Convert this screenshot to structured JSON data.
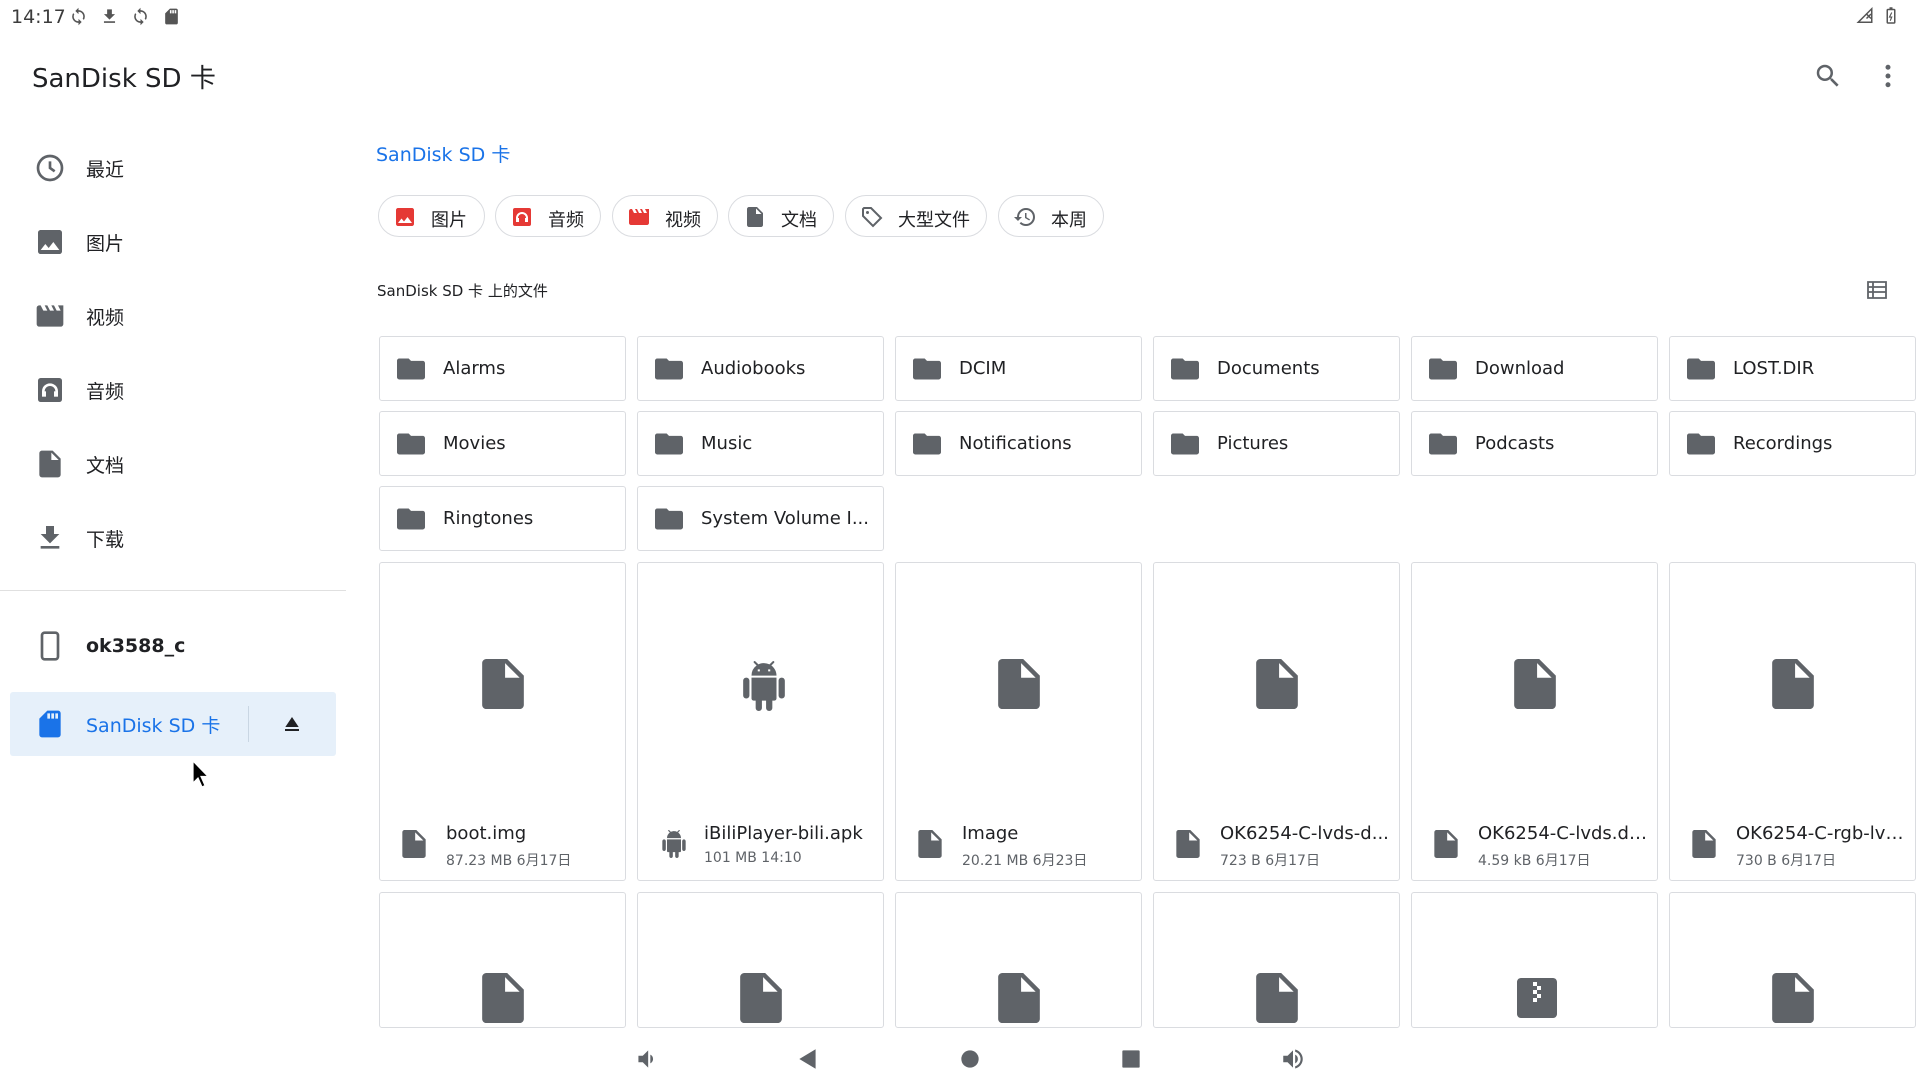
{
  "status_bar": {
    "time": "14:17",
    "left_icons": [
      "sync-icon",
      "download-icon",
      "sync-icon",
      "sd-card-icon"
    ],
    "right_icons": [
      "signal-icon",
      "battery-icon"
    ]
  },
  "app_bar": {
    "title": "SanDisk SD 卡",
    "actions": [
      "search-icon",
      "more-vert-icon"
    ]
  },
  "sidebar": {
    "items": [
      {
        "label": "最近",
        "icon": "clock-icon"
      },
      {
        "label": "图片",
        "icon": "image-icon"
      },
      {
        "label": "视频",
        "icon": "video-icon"
      },
      {
        "label": "音频",
        "icon": "headphones-icon"
      },
      {
        "label": "文档",
        "icon": "document-icon"
      },
      {
        "label": "下载",
        "icon": "download-icon"
      }
    ],
    "devices": [
      {
        "label": "ok3588_c",
        "icon": "phone-icon"
      },
      {
        "label": "SanDisk SD 卡",
        "icon": "sd-card-icon",
        "active": true,
        "action": "eject-icon"
      }
    ]
  },
  "main": {
    "breadcrumb": "SanDisk SD 卡",
    "chips": [
      {
        "label": "图片",
        "icon": "image-icon",
        "color": "#e53935"
      },
      {
        "label": "音频",
        "icon": "headphones-icon",
        "color": "#e53935"
      },
      {
        "label": "视频",
        "icon": "video-icon",
        "color": "#e53935"
      },
      {
        "label": "文档",
        "icon": "document-icon",
        "color": "#5f6368"
      },
      {
        "label": "大型文件",
        "icon": "tag-icon",
        "color": "#5f6368"
      },
      {
        "label": "本周",
        "icon": "history-icon",
        "color": "#5f6368"
      }
    ],
    "section_title": "SanDisk SD 卡 上的文件",
    "folders": [
      "Alarms",
      "Audiobooks",
      "DCIM",
      "Documents",
      "Download",
      "LOST.DIR",
      "Movies",
      "Music",
      "Notifications",
      "Pictures",
      "Podcasts",
      "Recordings",
      "Ringtones",
      "System Volume I..."
    ],
    "files": [
      {
        "name": "boot.img",
        "meta": "87.23 MB 6月17日",
        "icon": "file-icon"
      },
      {
        "name": "iBiliPlayer-bili.apk",
        "meta": "101 MB 14:10",
        "icon": "android-icon"
      },
      {
        "name": "Image",
        "meta": "20.21 MB 6月23日",
        "icon": "file-icon"
      },
      {
        "name": "OK6254-C-lvds-d...",
        "meta": "723 B 6月17日",
        "icon": "file-icon"
      },
      {
        "name": "OK6254-C-lvds.dt...",
        "meta": "4.59 kB 6月17日",
        "icon": "file-icon"
      },
      {
        "name": "OK6254-C-rgb-lvd...",
        "meta": "730 B 6月17日",
        "icon": "file-icon"
      }
    ],
    "partial_row_icons": [
      "file-icon",
      "file-icon",
      "file-icon",
      "file-icon",
      "zip-icon",
      "file-icon"
    ]
  },
  "nav_bar": {
    "buttons": [
      "volume-down-icon",
      "back-icon",
      "home-icon",
      "recents-icon",
      "volume-up-icon"
    ]
  },
  "colors": {
    "accent": "#1a73e8",
    "active_bg": "#e6f0fa",
    "icon_gray": "#5f6368",
    "chip_red": "#e53935"
  }
}
